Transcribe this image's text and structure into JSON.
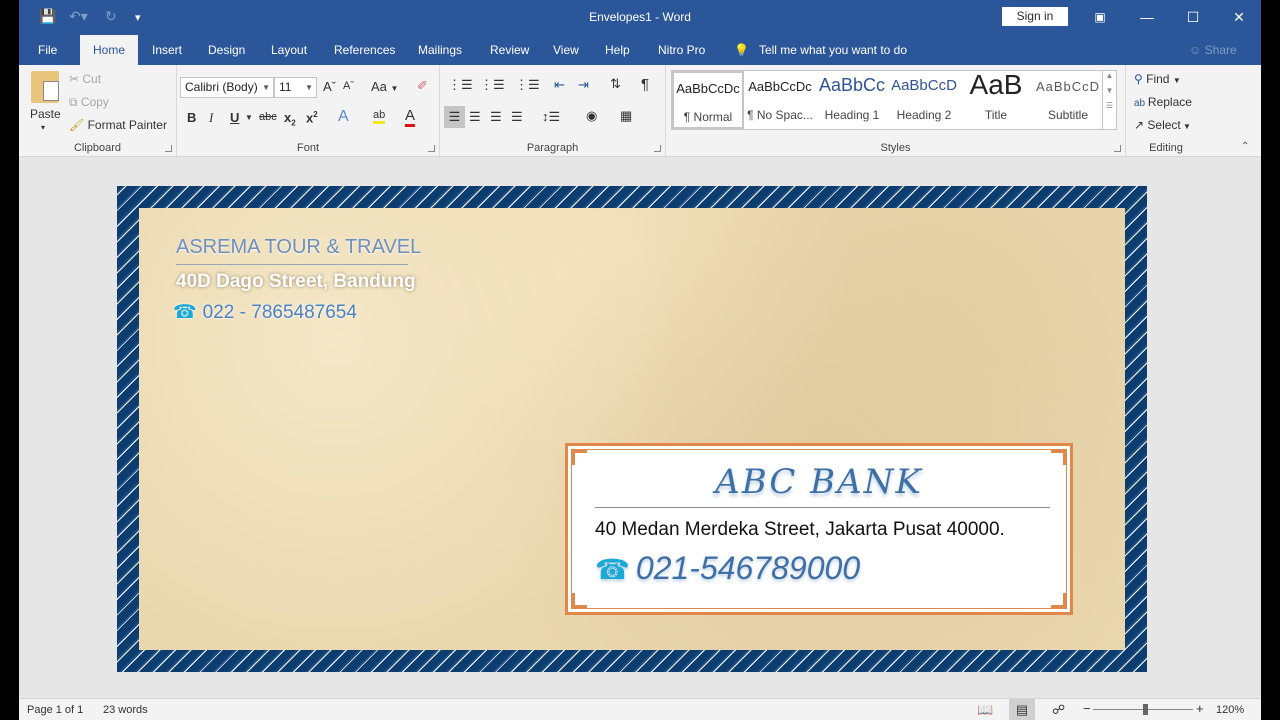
{
  "window": {
    "title": "Envelopes1  -  Word",
    "sign_in": "Sign in",
    "quick_access": [
      "save-icon",
      "undo-icon",
      "redo-icon",
      "customize-icon"
    ]
  },
  "tabs": [
    "File",
    "Home",
    "Insert",
    "Design",
    "Layout",
    "References",
    "Mailings",
    "Review",
    "View",
    "Help",
    "Nitro Pro"
  ],
  "active_tab": "Home",
  "tell_me": "Tell me what you want to do",
  "share": "Share",
  "ribbon": {
    "clipboard": {
      "label": "Clipboard",
      "paste": "Paste",
      "cut": "Cut",
      "copy": "Copy",
      "format_painter": "Format Painter"
    },
    "font": {
      "label": "Font",
      "font_name": "Calibri (Body)",
      "font_size": "11",
      "change_case": "Aa"
    },
    "paragraph": {
      "label": "Paragraph"
    },
    "styles": {
      "label": "Styles",
      "items": [
        {
          "preview": "AaBbCcDc",
          "name": "¶ Normal"
        },
        {
          "preview": "AaBbCcDc",
          "name": "¶ No Spac..."
        },
        {
          "preview": "AaBbCc",
          "name": "Heading 1"
        },
        {
          "preview": "AaBbCcD",
          "name": "Heading 2"
        },
        {
          "preview": "AaB",
          "name": "Title"
        },
        {
          "preview": "AaBbCcD",
          "name": "Subtitle"
        }
      ]
    },
    "editing": {
      "label": "Editing",
      "find": "Find",
      "replace": "Replace",
      "select": "Select"
    }
  },
  "document": {
    "return_address": {
      "company": "ASREMA TOUR & TRAVEL",
      "street": "40D Dago Street, Bandung",
      "phone": "022 - 7865487654"
    },
    "delivery_address": {
      "name": "ABC BANK",
      "street": "40 Medan Merdeka Street, Jakarta Pusat 40000.",
      "phone": "021-546789000"
    },
    "colors": {
      "border_blue": "#0d3c6e",
      "frame_orange": "#e0884a",
      "text_blue": "#3f6fa7"
    }
  },
  "status": {
    "page": "Page 1 of 1",
    "words": "23 words",
    "zoom": "120%",
    "zoom_percent": 120
  }
}
